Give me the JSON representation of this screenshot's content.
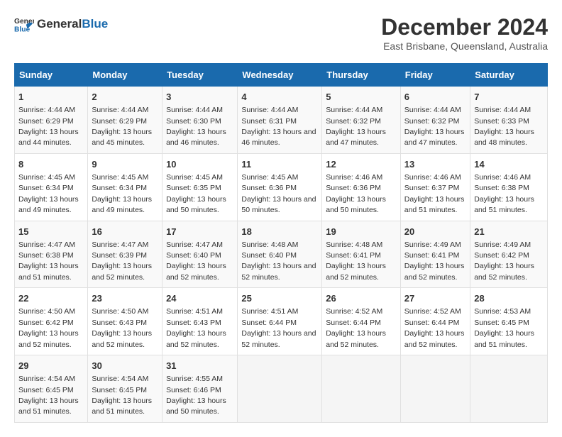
{
  "logo": {
    "general": "General",
    "blue": "Blue"
  },
  "title": "December 2024",
  "subtitle": "East Brisbane, Queensland, Australia",
  "days_of_week": [
    "Sunday",
    "Monday",
    "Tuesday",
    "Wednesday",
    "Thursday",
    "Friday",
    "Saturday"
  ],
  "weeks": [
    [
      {
        "day": "1",
        "sunrise": "4:44 AM",
        "sunset": "6:29 PM",
        "daylight": "13 hours and 44 minutes."
      },
      {
        "day": "2",
        "sunrise": "4:44 AM",
        "sunset": "6:29 PM",
        "daylight": "13 hours and 45 minutes."
      },
      {
        "day": "3",
        "sunrise": "4:44 AM",
        "sunset": "6:30 PM",
        "daylight": "13 hours and 46 minutes."
      },
      {
        "day": "4",
        "sunrise": "4:44 AM",
        "sunset": "6:31 PM",
        "daylight": "13 hours and 46 minutes."
      },
      {
        "day": "5",
        "sunrise": "4:44 AM",
        "sunset": "6:32 PM",
        "daylight": "13 hours and 47 minutes."
      },
      {
        "day": "6",
        "sunrise": "4:44 AM",
        "sunset": "6:32 PM",
        "daylight": "13 hours and 47 minutes."
      },
      {
        "day": "7",
        "sunrise": "4:44 AM",
        "sunset": "6:33 PM",
        "daylight": "13 hours and 48 minutes."
      }
    ],
    [
      {
        "day": "8",
        "sunrise": "4:45 AM",
        "sunset": "6:34 PM",
        "daylight": "13 hours and 49 minutes."
      },
      {
        "day": "9",
        "sunrise": "4:45 AM",
        "sunset": "6:34 PM",
        "daylight": "13 hours and 49 minutes."
      },
      {
        "day": "10",
        "sunrise": "4:45 AM",
        "sunset": "6:35 PM",
        "daylight": "13 hours and 50 minutes."
      },
      {
        "day": "11",
        "sunrise": "4:45 AM",
        "sunset": "6:36 PM",
        "daylight": "13 hours and 50 minutes."
      },
      {
        "day": "12",
        "sunrise": "4:46 AM",
        "sunset": "6:36 PM",
        "daylight": "13 hours and 50 minutes."
      },
      {
        "day": "13",
        "sunrise": "4:46 AM",
        "sunset": "6:37 PM",
        "daylight": "13 hours and 51 minutes."
      },
      {
        "day": "14",
        "sunrise": "4:46 AM",
        "sunset": "6:38 PM",
        "daylight": "13 hours and 51 minutes."
      }
    ],
    [
      {
        "day": "15",
        "sunrise": "4:47 AM",
        "sunset": "6:38 PM",
        "daylight": "13 hours and 51 minutes."
      },
      {
        "day": "16",
        "sunrise": "4:47 AM",
        "sunset": "6:39 PM",
        "daylight": "13 hours and 52 minutes."
      },
      {
        "day": "17",
        "sunrise": "4:47 AM",
        "sunset": "6:40 PM",
        "daylight": "13 hours and 52 minutes."
      },
      {
        "day": "18",
        "sunrise": "4:48 AM",
        "sunset": "6:40 PM",
        "daylight": "13 hours and 52 minutes."
      },
      {
        "day": "19",
        "sunrise": "4:48 AM",
        "sunset": "6:41 PM",
        "daylight": "13 hours and 52 minutes."
      },
      {
        "day": "20",
        "sunrise": "4:49 AM",
        "sunset": "6:41 PM",
        "daylight": "13 hours and 52 minutes."
      },
      {
        "day": "21",
        "sunrise": "4:49 AM",
        "sunset": "6:42 PM",
        "daylight": "13 hours and 52 minutes."
      }
    ],
    [
      {
        "day": "22",
        "sunrise": "4:50 AM",
        "sunset": "6:42 PM",
        "daylight": "13 hours and 52 minutes."
      },
      {
        "day": "23",
        "sunrise": "4:50 AM",
        "sunset": "6:43 PM",
        "daylight": "13 hours and 52 minutes."
      },
      {
        "day": "24",
        "sunrise": "4:51 AM",
        "sunset": "6:43 PM",
        "daylight": "13 hours and 52 minutes."
      },
      {
        "day": "25",
        "sunrise": "4:51 AM",
        "sunset": "6:44 PM",
        "daylight": "13 hours and 52 minutes."
      },
      {
        "day": "26",
        "sunrise": "4:52 AM",
        "sunset": "6:44 PM",
        "daylight": "13 hours and 52 minutes."
      },
      {
        "day": "27",
        "sunrise": "4:52 AM",
        "sunset": "6:44 PM",
        "daylight": "13 hours and 52 minutes."
      },
      {
        "day": "28",
        "sunrise": "4:53 AM",
        "sunset": "6:45 PM",
        "daylight": "13 hours and 51 minutes."
      }
    ],
    [
      {
        "day": "29",
        "sunrise": "4:54 AM",
        "sunset": "6:45 PM",
        "daylight": "13 hours and 51 minutes."
      },
      {
        "day": "30",
        "sunrise": "4:54 AM",
        "sunset": "6:45 PM",
        "daylight": "13 hours and 51 minutes."
      },
      {
        "day": "31",
        "sunrise": "4:55 AM",
        "sunset": "6:46 PM",
        "daylight": "13 hours and 50 minutes."
      },
      null,
      null,
      null,
      null
    ]
  ]
}
